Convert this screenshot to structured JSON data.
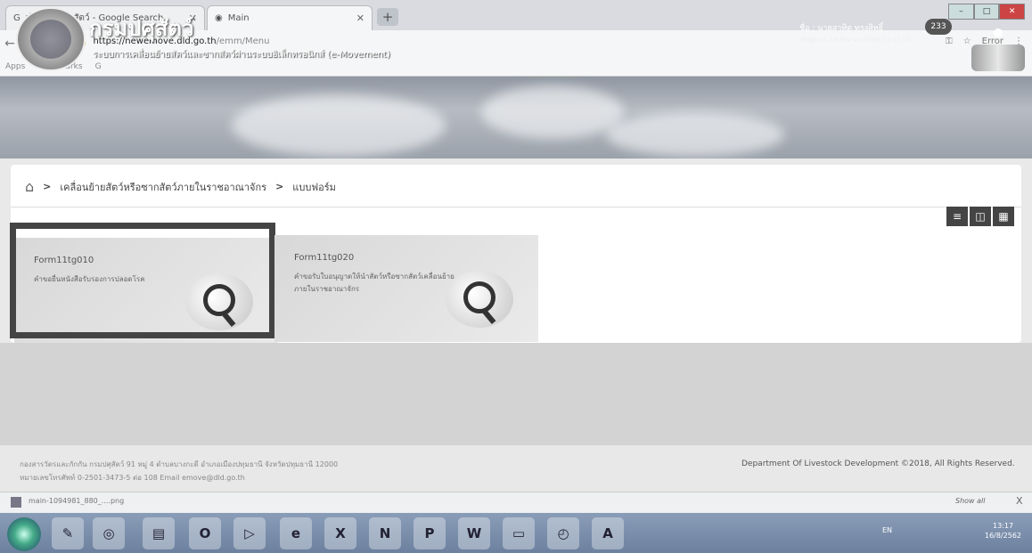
{
  "browser": {
    "tabs": [
      {
        "title": "เฝ้าระวังโรคสัตว์ - Google Search"
      },
      {
        "title": "Main"
      }
    ],
    "new_tab": "+",
    "url_domain": "https://newemove.dld.go.th",
    "url_path": "/emm/Menu",
    "bookmarks": [
      "Apps",
      "Bookmarks",
      "G"
    ],
    "profile": "Error"
  },
  "site": {
    "title": "กรมปศุสัตว์",
    "subtitle": "ระบบการเคลื่อนย้ายสัตว์และซากสัตว์ผ่านระบบอิเล็กทรอนิกส์ (e-Movement)",
    "user_name": "ชื่อ : นายสาทิต ทรงสิทธิ์",
    "user_date": "เข้าสู่ระบบ 16 สิงหาคม 2562 13:17:03",
    "badge": "233"
  },
  "breadcrumb": {
    "items": [
      "เคลื่อนย้ายสัตว์หรือซากสัตว์ภายในราชอาณาจักร",
      "แบบฟอร์ม"
    ]
  },
  "cards": [
    {
      "code": "Form11tg010",
      "desc": "คำขอยื่นหนังสือรับรองการปลอดโรค"
    },
    {
      "code": "Form11tg020",
      "desc": "คำขอรับใบอนุญาตให้นำสัตว์หรือซากสัตว์เคลื่อนย้ายภายในราชอาณาจักร"
    }
  ],
  "footer": {
    "address_line1": "กองสารวัตรและกักกัน กรมปศุสัตว์ 91 หมู่ 4 ตำบลบางกะดี อำเภอเมืองปทุมธานี จังหวัดปทุมธานี 12000",
    "address_line2": "หมายเลขโทรศัพท์ 0-2501-3473-5 ต่อ 108 Email emove@dld.go.th",
    "copyright": "Department Of Livestock Development ©2018, All Rights Reserved."
  },
  "downloads": {
    "file": "main-1094981_880_....png",
    "show_all": "Show all",
    "close": "X"
  },
  "taskbar": {
    "tray": "EN",
    "time": "13:17",
    "date": "16/8/2562"
  }
}
